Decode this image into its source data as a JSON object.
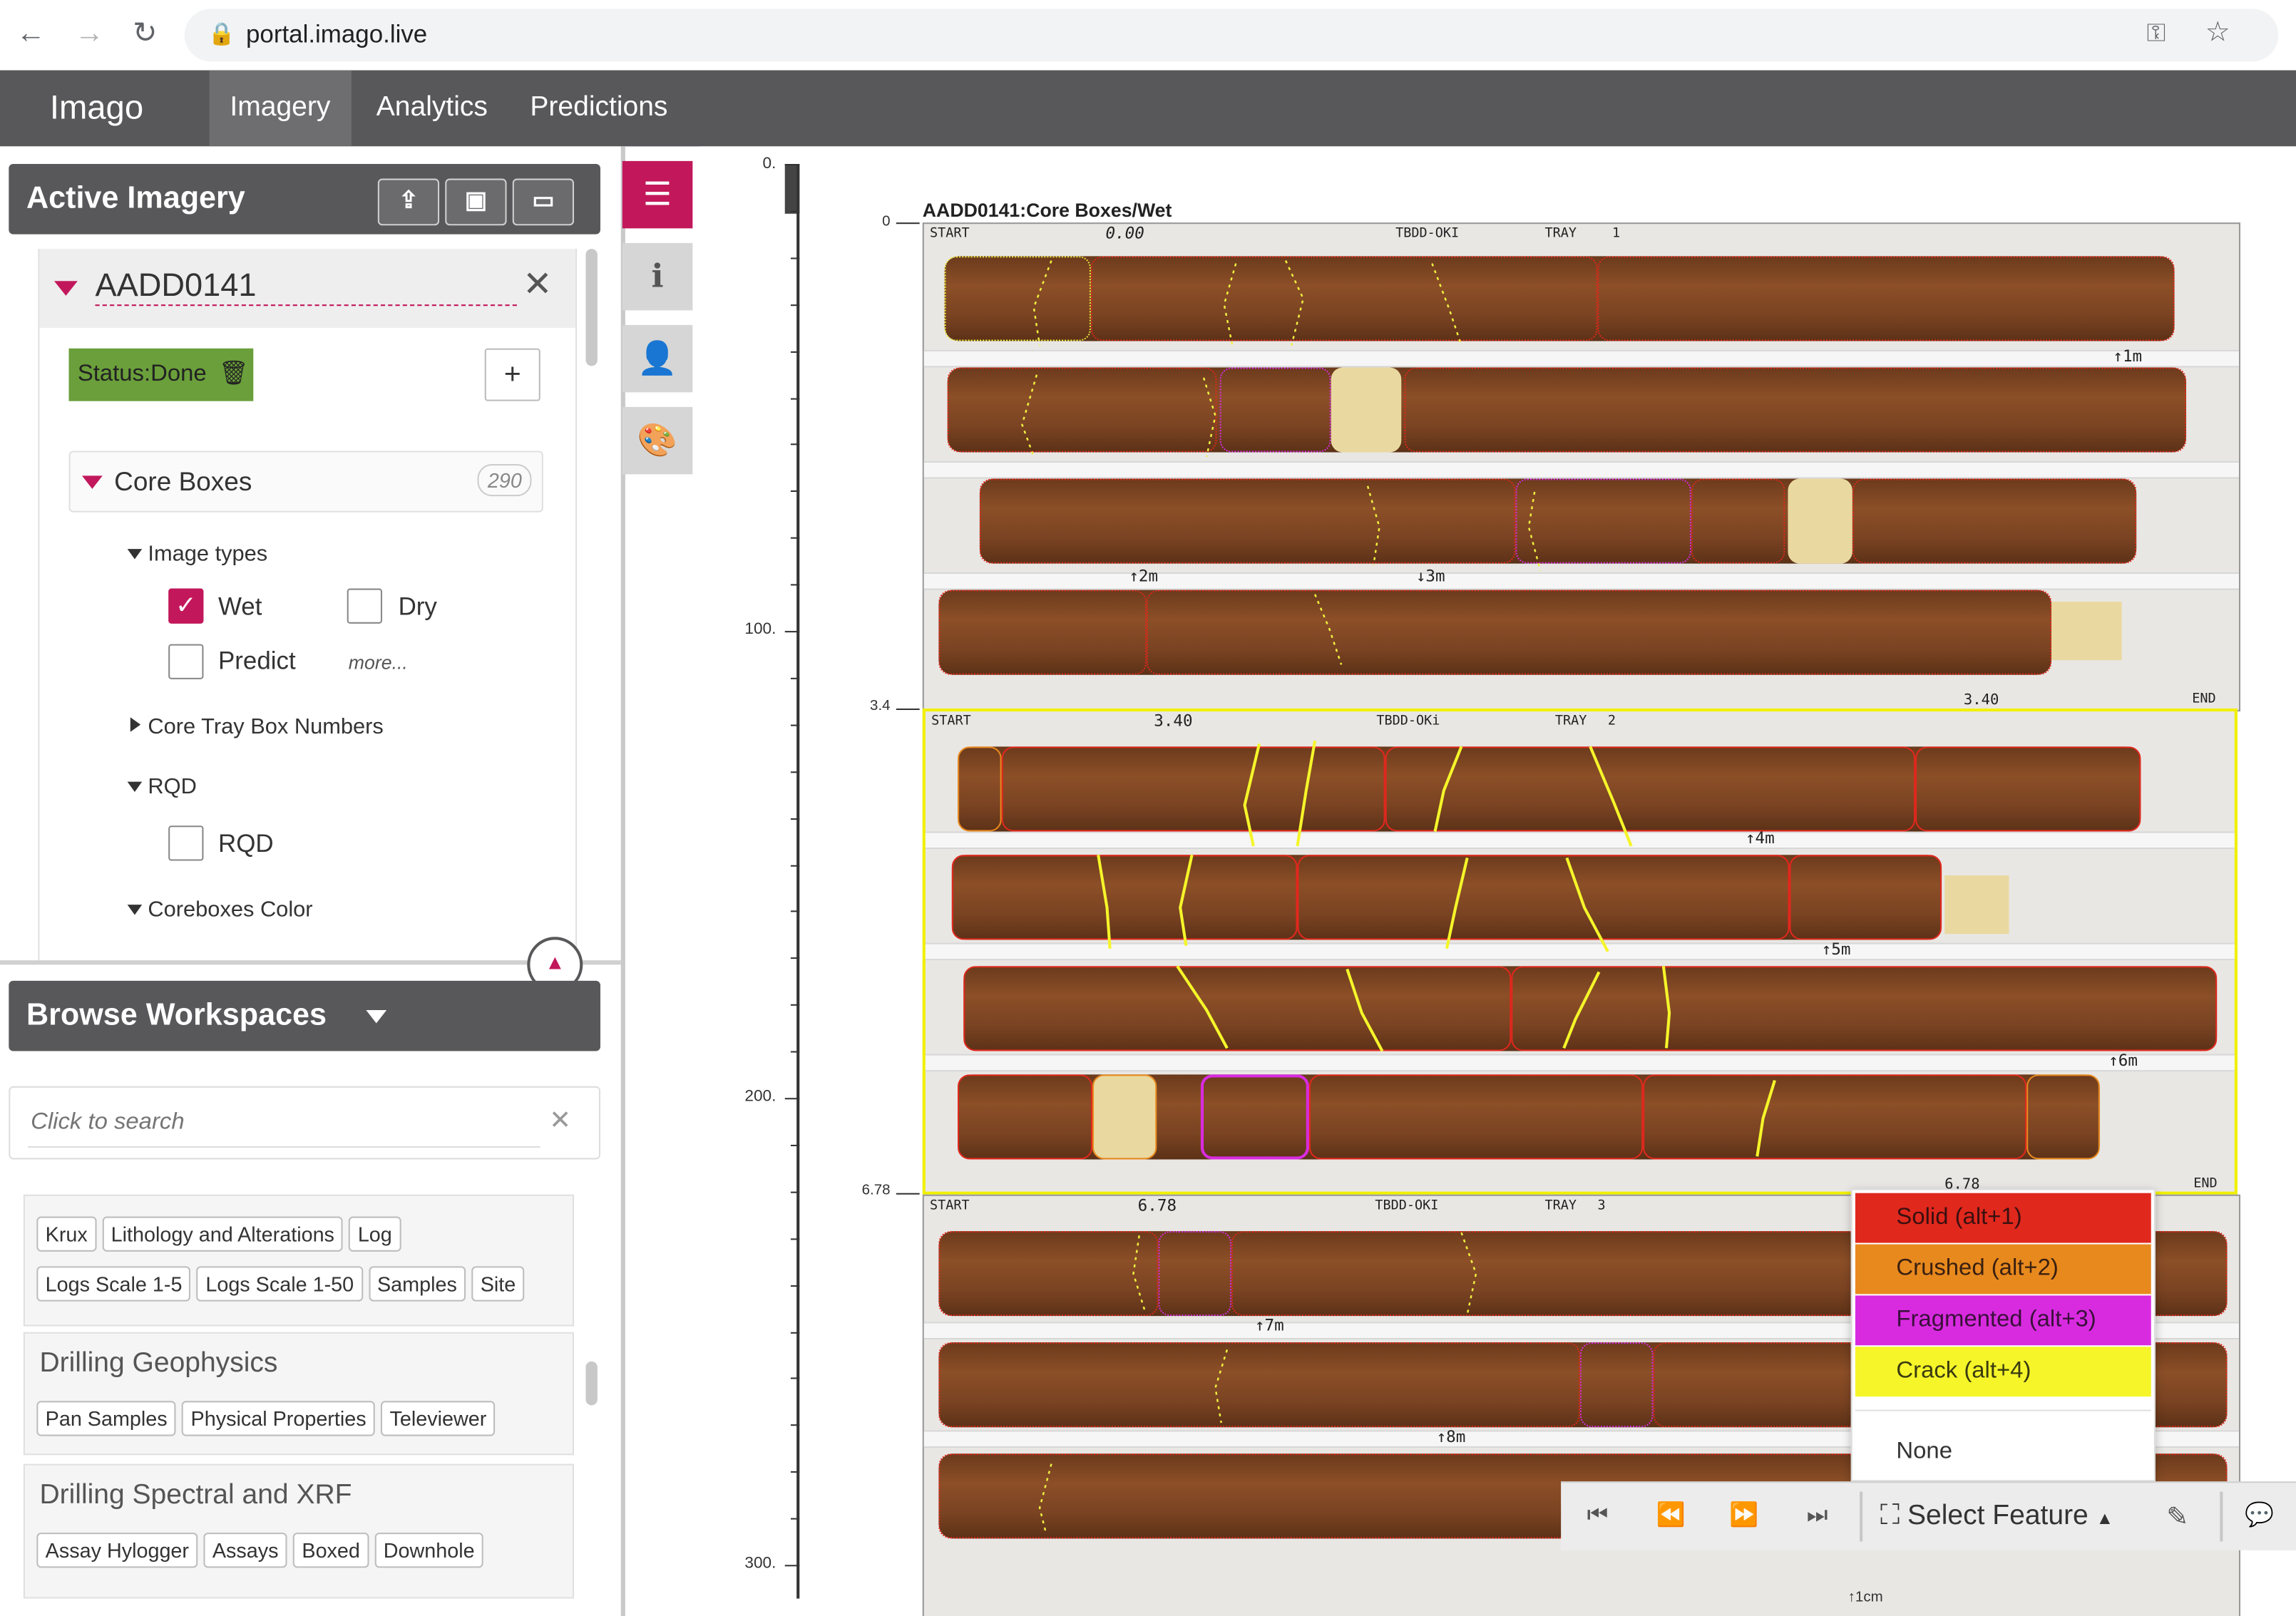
{
  "browser": {
    "url": "portal.imago.live"
  },
  "app": {
    "logo": "Imago",
    "tabs": [
      "Imagery",
      "Analytics",
      "Predictions"
    ],
    "active_tab": "Imagery"
  },
  "active_imagery": {
    "title": "Active Imagery",
    "dataset": "AADD0141",
    "status": "Status:Done",
    "core_boxes": {
      "label": "Core Boxes",
      "count": "290"
    },
    "image_types": {
      "label": "Image types",
      "wet": "Wet",
      "dry": "Dry",
      "predict": "Predict",
      "more": "more...",
      "wet_checked": true,
      "dry_checked": false,
      "predict_checked": false
    },
    "tray_numbers": "Core Tray Box Numbers",
    "rqd": {
      "label": "RQD",
      "checkbox": "RQD"
    },
    "coreboxes_color": "Coreboxes Color"
  },
  "browse": {
    "title": "Browse Workspaces",
    "search_placeholder": "Click to search",
    "group0_tags": [
      "Krux",
      "Lithology and Alterations",
      "Log",
      "Logs Scale 1-5",
      "Logs Scale 1-50",
      "Samples",
      "Site"
    ],
    "groups": [
      {
        "title": "Drilling Geophysics",
        "tags": [
          "Pan Samples",
          "Physical Properties",
          "Televiewer"
        ]
      },
      {
        "title": "Drilling Spectral and XRF",
        "tags": [
          "Assay Hylogger",
          "Assays",
          "Boxed",
          "Downhole"
        ]
      }
    ]
  },
  "ruler": {
    "top_label": "0.",
    "labels": [
      "100.",
      "200.",
      "300."
    ],
    "depth_labels": [
      "0",
      "3.4",
      "6.78"
    ]
  },
  "viewer": {
    "caption": "AADD0141:Core Boxes/Wet",
    "trays": [
      {
        "start": "START",
        "from": "0.00",
        "hole": "TBDD-OKI",
        "tray": "TRAY",
        "num": "1",
        "end": "END",
        "to": "3.40",
        "marks": [
          "↑1m",
          "↑2m",
          "↓3m"
        ]
      },
      {
        "start": "START",
        "from": "3.40",
        "hole": "TBDD-OKi",
        "tray": "TRAY",
        "num": "2",
        "end": "END",
        "to": "6.78",
        "marks": [
          "↑4m",
          "↑5m",
          "↑6m"
        ]
      },
      {
        "start": "START",
        "from": "6.78",
        "hole": "TBDD-OKI",
        "tray": "TRAY",
        "num": "3",
        "marks": [
          "↑7m",
          "↑8m"
        ]
      }
    ]
  },
  "feature_menu": {
    "items": [
      {
        "label": "Solid (alt+1)",
        "color": "#e0281d"
      },
      {
        "label": "Crushed (alt+2)",
        "color": "#e8891e"
      },
      {
        "label": "Fragmented (alt+3)",
        "color": "#d82be0"
      },
      {
        "label": "Crack (alt+4)",
        "color": "#f5f52a"
      }
    ],
    "none": "None",
    "select_label": "Select Feature"
  },
  "colors": {
    "accent": "#c2185b",
    "header": "#58585a",
    "status_green": "#6a9f3b",
    "tray_highlight": "#f0f000"
  }
}
